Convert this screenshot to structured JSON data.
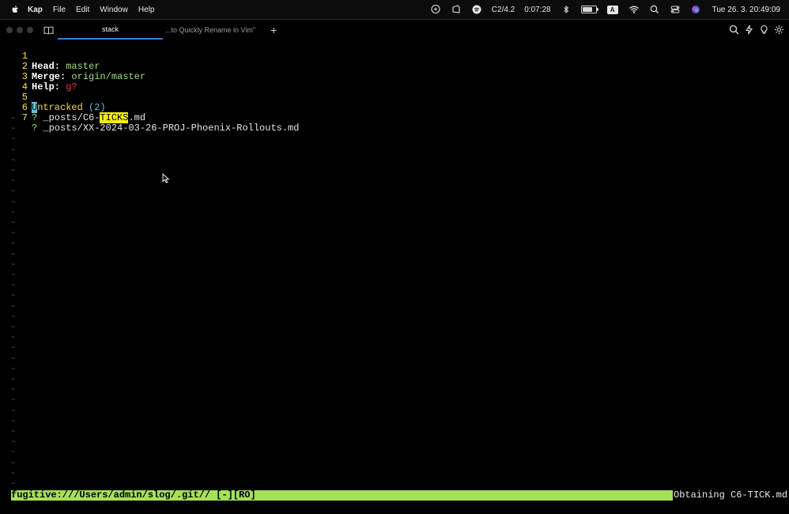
{
  "menubar": {
    "app": "Kap",
    "items": [
      "File",
      "Edit",
      "Window",
      "Help"
    ],
    "tracker_text": "C2/4.2",
    "timer": "0:07:28",
    "input_source": "A",
    "datetime": "Tue 26. 3.  20:49:09",
    "icons": [
      "apple-icon",
      "speech-icon",
      "screen-record-icon",
      "spotify-icon",
      "bluetooth-icon",
      "battery-icon",
      "wifi-icon",
      "search-icon",
      "control-center-icon",
      "siri-icon"
    ]
  },
  "window": {
    "tabs": [
      {
        "label": "stack",
        "active": true
      },
      {
        "label": "...to Quickly Rename in Vim\"",
        "active": false
      }
    ],
    "add_tab": "+",
    "tools": [
      "search-icon",
      "bolt-icon",
      "bulb-icon",
      "settings-icon"
    ]
  },
  "buffer": {
    "lines": [
      {
        "num": "1",
        "key": "Head:",
        "value": "master"
      },
      {
        "num": "2",
        "key": "Merge:",
        "value": "origin/master"
      },
      {
        "num": "3",
        "key": "Help:",
        "value": "g?"
      },
      {
        "num": "4"
      },
      {
        "num": "5",
        "cursor_char": "U",
        "section": "ntracked",
        "count": "(2)"
      },
      {
        "num": "6",
        "marker": "?",
        "path_pre": "_posts/C6-",
        "match": "TICKS",
        "path_post": ".md"
      },
      {
        "num": "7",
        "marker": "?",
        "path": "_posts/XX-2024-03-26-PROJ-Phoenix-Rollouts.md"
      }
    ],
    "tilde": "~",
    "tilde_count": 36
  },
  "statusline": "fugitive:///Users/admin/slog/.git// [-][RO]",
  "message": "Obtaining C6-TICK.md",
  "colors": {
    "statusline_bg": "#a4e05a",
    "line_number": "#f4e44a",
    "branch": "#9fe07a",
    "help": "#e23a3a",
    "section": "#f2d64b",
    "search_highlight": "#f4f400",
    "tab_underline": "#3b7ed8"
  }
}
